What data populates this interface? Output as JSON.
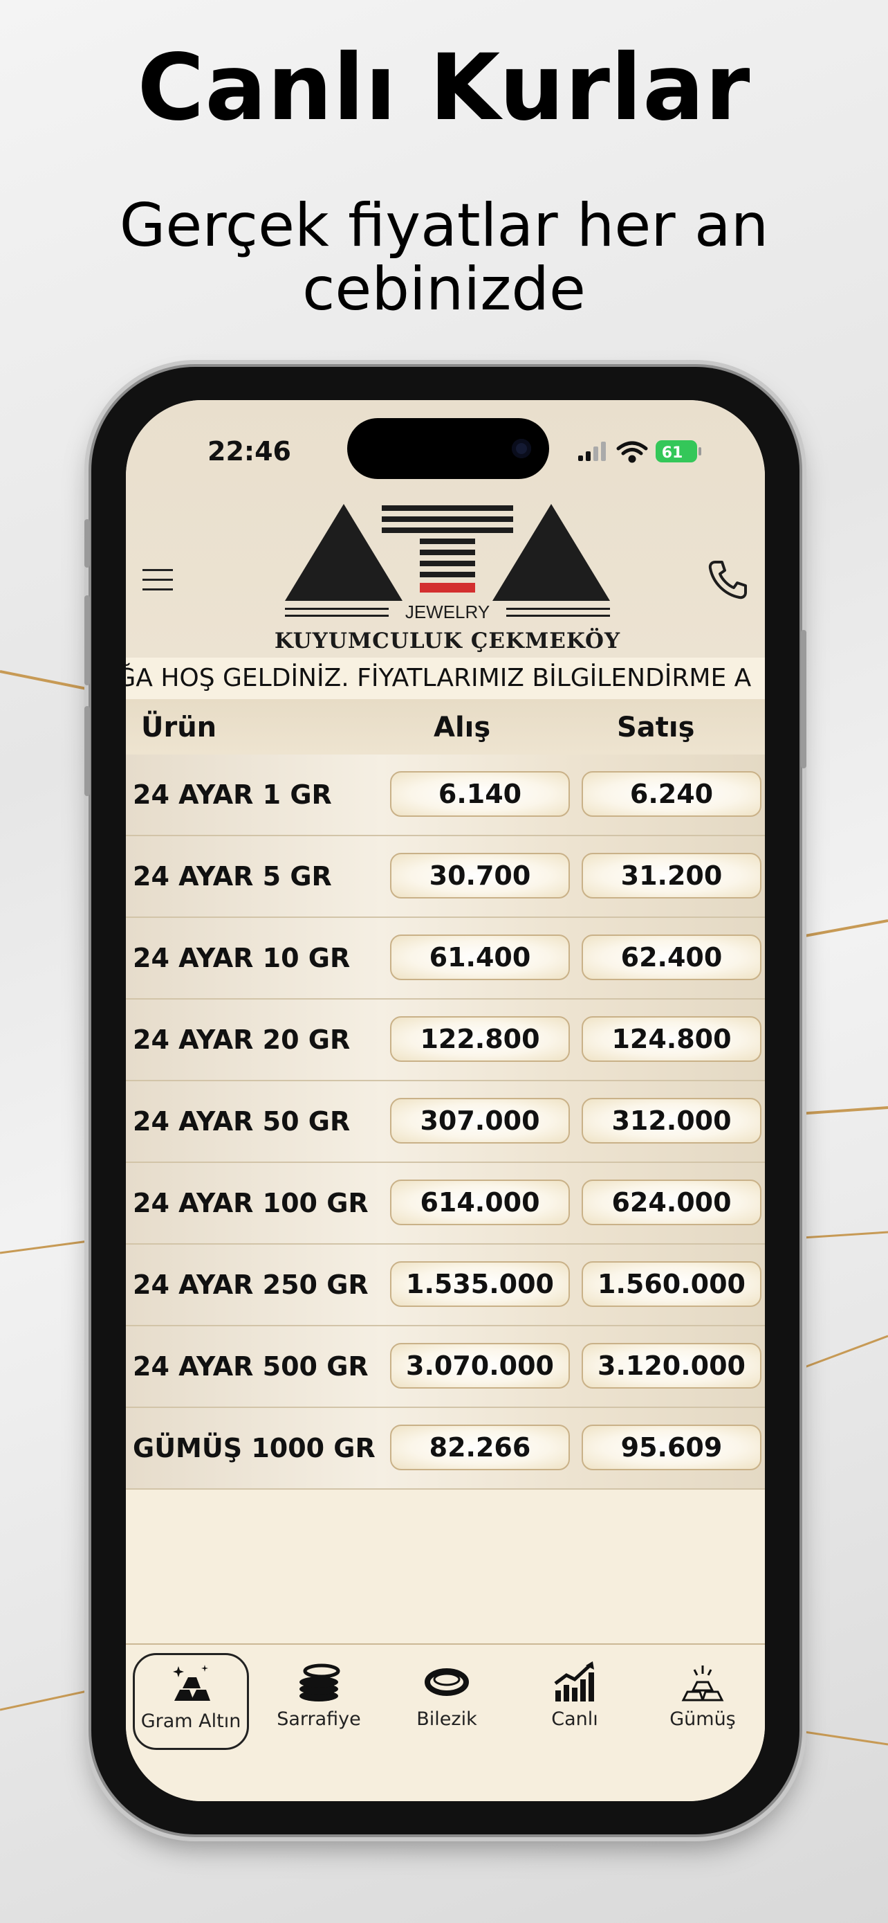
{
  "promo": {
    "title": "Canlı Kurlar",
    "subtitle": "Gerçek fiyatlar her an cebinizde"
  },
  "status_bar": {
    "time": "22:46",
    "battery": "61"
  },
  "brand": {
    "logo_text": "JEWELRY",
    "name": "KUYUMCULUK ÇEKMEKÖY"
  },
  "marquee": "UĞA HOŞ GELDİNİZ. FİYATLARIMIZ BİLGİLENDİRME A",
  "table": {
    "headers": [
      "Ürün",
      "Alış",
      "Satış"
    ],
    "rows": [
      {
        "name": "24 AYAR 1 GR",
        "buy": "6.140",
        "sell": "6.240"
      },
      {
        "name": "24 AYAR 5 GR",
        "buy": "30.700",
        "sell": "31.200"
      },
      {
        "name": "24 AYAR 10 GR",
        "buy": "61.400",
        "sell": "62.400"
      },
      {
        "name": "24 AYAR 20 GR",
        "buy": "122.800",
        "sell": "124.800"
      },
      {
        "name": "24 AYAR 50 GR",
        "buy": "307.000",
        "sell": "312.000"
      },
      {
        "name": "24 AYAR 100 GR",
        "buy": "614.000",
        "sell": "624.000"
      },
      {
        "name": "24 AYAR 250 GR",
        "buy": "1.535.000",
        "sell": "1.560.000"
      },
      {
        "name": "24 AYAR 500 GR",
        "buy": "3.070.000",
        "sell": "3.120.000"
      },
      {
        "name": "GÜMÜŞ 1000 GR",
        "buy": "82.266",
        "sell": "95.609"
      }
    ]
  },
  "tabs": [
    {
      "label": "Gram Altın",
      "icon": "gold-bars-icon",
      "active": true
    },
    {
      "label": "Sarrafiye",
      "icon": "coins-icon",
      "active": false
    },
    {
      "label": "Bilezik",
      "icon": "bracelet-icon",
      "active": false
    },
    {
      "label": "Canlı",
      "icon": "chart-up-icon",
      "active": false
    },
    {
      "label": "Gümüş",
      "icon": "silver-bars-icon",
      "active": false
    }
  ],
  "colors": {
    "screen_bg": "#f6eedd",
    "pill_border": "#c9b188",
    "logo_red": "#d32f2f"
  }
}
